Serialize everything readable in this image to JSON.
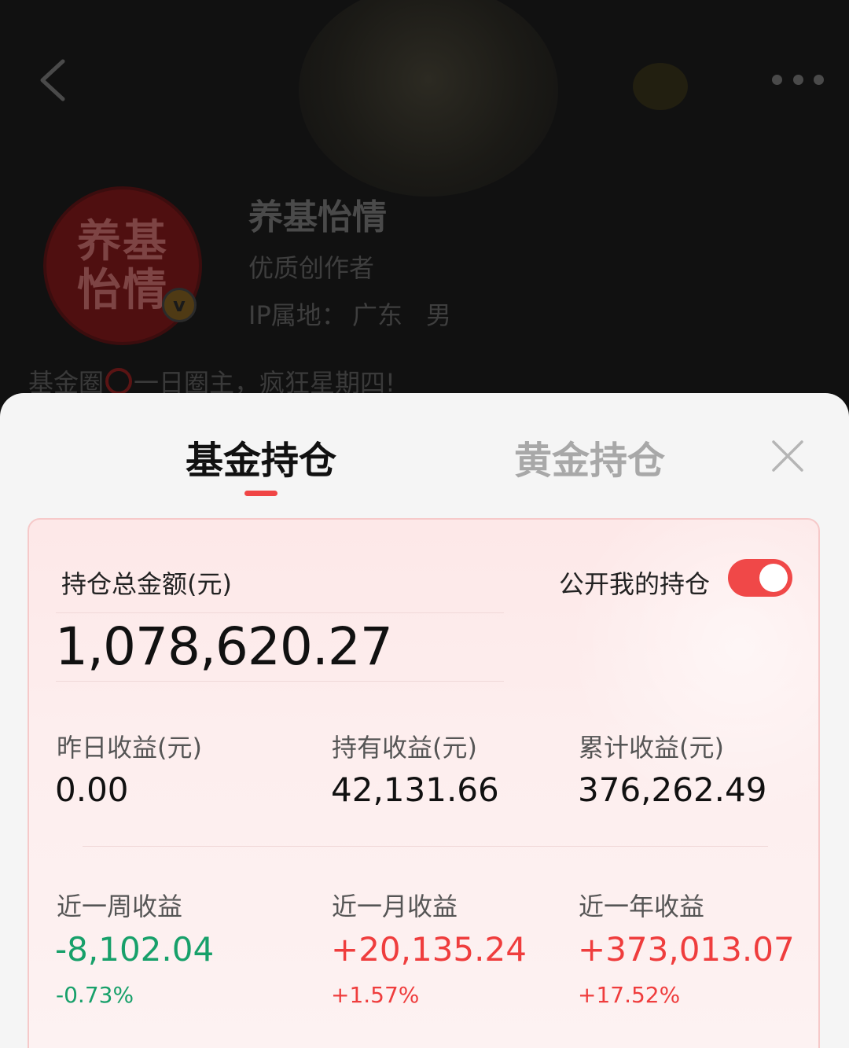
{
  "profile": {
    "avatar_text": "养基怡情",
    "verify_badge": "v",
    "name": "养基怡情",
    "role": "优质创作者",
    "role_extra": "",
    "ip_label": "IP属地：",
    "ip_value": "广东",
    "gender": "男",
    "bio_prefix": "基金圈",
    "bio_suffix": "一日圈主，疯狂星期四!"
  },
  "sheet": {
    "tabs": [
      {
        "label": "基金持仓",
        "active": true
      },
      {
        "label": "黄金持仓",
        "active": false
      }
    ],
    "total_label": "持仓总金额(元)",
    "total_value": "1,078,620.27",
    "public_label": "公开我的持仓",
    "public_on": true,
    "stats_row1": [
      {
        "label": "昨日收益(元)",
        "value": "0.00"
      },
      {
        "label": "持有收益(元)",
        "value": "42,131.66"
      },
      {
        "label": "累计收益(元)",
        "value": "376,262.49"
      }
    ],
    "stats_row2": [
      {
        "label": "近一周收益",
        "value": "-8,102.04",
        "pct": "-0.73%",
        "trend": "down"
      },
      {
        "label": "近一月收益",
        "value": "+20,135.24",
        "pct": "+1.57%",
        "trend": "up"
      },
      {
        "label": "近一年收益",
        "value": "+373,013.07",
        "pct": "+17.52%",
        "trend": "up"
      }
    ]
  },
  "colors": {
    "accent_red": "#f04545",
    "gain_red": "#ef3d3d",
    "loss_green": "#17a06a",
    "inactive_tab": "#a8a8a8"
  }
}
